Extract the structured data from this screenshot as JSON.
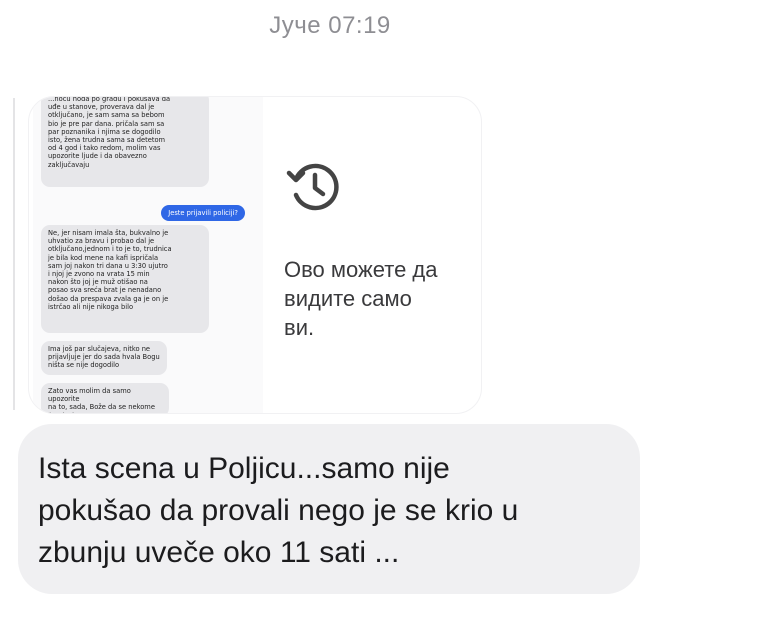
{
  "header": {
    "timestamp": "Јуче 07:19"
  },
  "shared_image": {
    "screenshot_messages": [
      {
        "dir": "in",
        "text": "...noću hoda po gradu i pokušava da\nuđe u stanove, proverava dal je\notključano, je sam sama sa bebom\nbio je pre par dana. pričala sam sa\npar poznanika i njima se dogodilo\nisto, žena trudna sama sa detetom\nod 4 god i tako redom, molim vas\nupozorite ljude i da obavezno\nzaključavaju"
      },
      {
        "dir": "out",
        "text": "Jeste prijavili policiji?"
      },
      {
        "dir": "in",
        "text": "Ne, jer nisam imala šta, bukvalno je\nuhvatio za bravu i probao dal je\notključano,jednom i to je to, trudnica\nje bila kod mene na kafi ispričala\nsam joj nakon tri dana u 3:30 ujutro\ni njoj je zvono na vrata 15 min\nnakon što joj je muž otišao na\nposao sva sreća brat je nenadano\ndošao da prespava zvala ga je on je\nistrčao ali nije nikoga bilo"
      },
      {
        "dir": "in",
        "text": "Ima još par slučajeva, nitko ne\nprijavljuje jer do sada hvala Bogu\nništa se nije dogodilo"
      },
      {
        "dir": "in",
        "text": "Zato vas molim da samo upozorite\nna to, sada, Bože da se nekome\nšta desi"
      }
    ],
    "view_once_icon": "history-clock-icon",
    "notice_text": "Ово можете да\nвидите само\nви."
  },
  "message": {
    "text": "Ista scena u Poljicu...samo nije\npokušao da provali nego je se krio u\nzbunju uveče oko 11 sati ..."
  },
  "colors": {
    "bubble_bg": "#f0f0f2",
    "outgoing_blue": "#2f67e6",
    "timestamp_gray": "#8e8e93"
  }
}
